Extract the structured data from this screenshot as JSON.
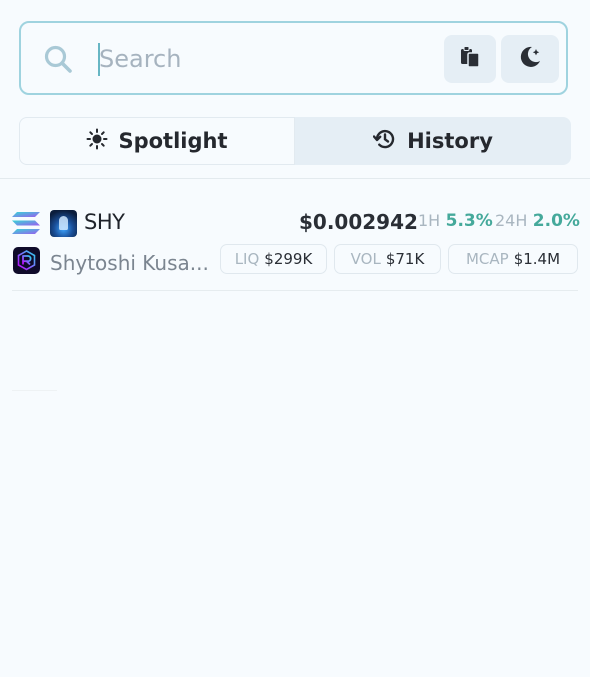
{
  "search": {
    "placeholder": "Search",
    "paste_icon": "clipboard-icon",
    "theme_icon": "moon-star-icon"
  },
  "tabs": [
    {
      "label": "Spotlight",
      "icon": "sun-icon",
      "active": true
    },
    {
      "label": "History",
      "icon": "history-icon",
      "active": false
    }
  ],
  "results": [
    {
      "chain_icon": "solana-icon",
      "symbol": "SHY",
      "name": "Shytoshi Kusa...",
      "dex_icon": "raydium-icon",
      "price": "$0.002942",
      "change_1h": {
        "label": "1H",
        "value": "5.3%"
      },
      "change_24h": {
        "label": "24H",
        "value": "2.0%"
      },
      "liq": {
        "label": "LIQ",
        "value": "$299K"
      },
      "vol": {
        "label": "VOL",
        "value": "$71K"
      },
      "mcap": {
        "label": "MCAP",
        "value": "$1.4M"
      }
    }
  ],
  "colors": {
    "accent": "#9fd3df",
    "positive": "#45a99b",
    "background": "#f7fbfe",
    "tab_bg": "#e5eef5"
  }
}
